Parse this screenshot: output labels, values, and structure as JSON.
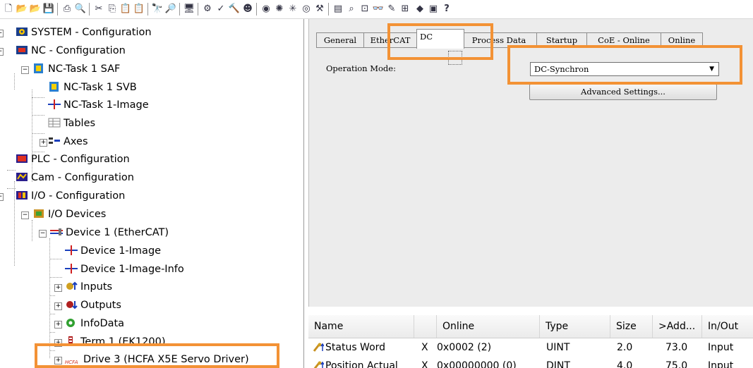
{
  "toolbar": {
    "icons": [
      "new-file-icon",
      "open-icon",
      "open-recent-icon",
      "save-icon",
      "print-icon",
      "print-preview-icon",
      "cut-icon",
      "copy-icon",
      "paste-icon",
      "paste-special-icon",
      "find-icon",
      "find-next-icon",
      "monitor-icon",
      "activate-config-icon",
      "check-icon",
      "build-icon",
      "login-icon",
      "run-icon",
      "scan-icon",
      "freerun-icon",
      "target-icon",
      "settings-icon",
      "view-icon",
      "zoom-icon",
      "graph-icon",
      "watch-icon",
      "network-icon",
      "io-icon",
      "book-icon",
      "info-icon",
      "help-icon"
    ]
  },
  "tree": {
    "items": [
      {
        "label": "SYSTEM - Configuration",
        "icon": "system-config-icon"
      },
      {
        "label": "NC - Configuration",
        "icon": "nc-config-icon"
      },
      {
        "label": "NC-Task 1 SAF",
        "icon": "task-icon"
      },
      {
        "label": "NC-Task 1 SVB",
        "icon": "task-icon"
      },
      {
        "label": "NC-Task 1-Image",
        "icon": "image-icon"
      },
      {
        "label": "Tables",
        "icon": "table-icon"
      },
      {
        "label": "Axes",
        "icon": "axes-icon"
      },
      {
        "label": "PLC - Configuration",
        "icon": "plc-config-icon"
      },
      {
        "label": "Cam - Configuration",
        "icon": "cam-config-icon"
      },
      {
        "label": "I/O - Configuration",
        "icon": "io-config-icon"
      },
      {
        "label": "I/O Devices",
        "icon": "io-devices-icon"
      },
      {
        "label": "Device 1 (EtherCAT)",
        "icon": "ethercat-device-icon"
      },
      {
        "label": "Device 1-Image",
        "icon": "image-icon"
      },
      {
        "label": "Device 1-Image-Info",
        "icon": "image-icon"
      },
      {
        "label": "Inputs",
        "icon": "inputs-icon"
      },
      {
        "label": "Outputs",
        "icon": "outputs-icon"
      },
      {
        "label": "InfoData",
        "icon": "infodata-icon"
      },
      {
        "label": "Term 1 (EK1200)",
        "icon": "terminal-icon"
      },
      {
        "label": "Drive 3 (HCFA X5E Servo Driver)",
        "icon": "drive-icon",
        "drive_tag": "HCFA"
      }
    ]
  },
  "tabs": [
    "General",
    "EtherCAT",
    "DC",
    "Process Data",
    "Startup",
    "CoE - Online",
    "Online"
  ],
  "dc": {
    "operation_mode_label": "Operation Mode:",
    "operation_mode_value": "DC-Synchron",
    "advanced_settings_label": "Advanced Settings..."
  },
  "table": {
    "headers": [
      "Name",
      "",
      "Online",
      "Type",
      "Size",
      ">Add...",
      "In/Out"
    ],
    "rows": [
      {
        "name": "Status Word",
        "flag": "X",
        "online": "0x0002 (2)",
        "type": "UINT",
        "size": "2.0",
        "addr": "73.0",
        "inout": "Input"
      },
      {
        "name": "Position Actual",
        "flag": "X",
        "online": "0x00000000 (0)",
        "type": "DINT",
        "size": "4.0",
        "addr": "75.0",
        "inout": "Input"
      }
    ]
  },
  "colors": {
    "highlight": "#f39235",
    "panel_bg": "#ececec"
  }
}
